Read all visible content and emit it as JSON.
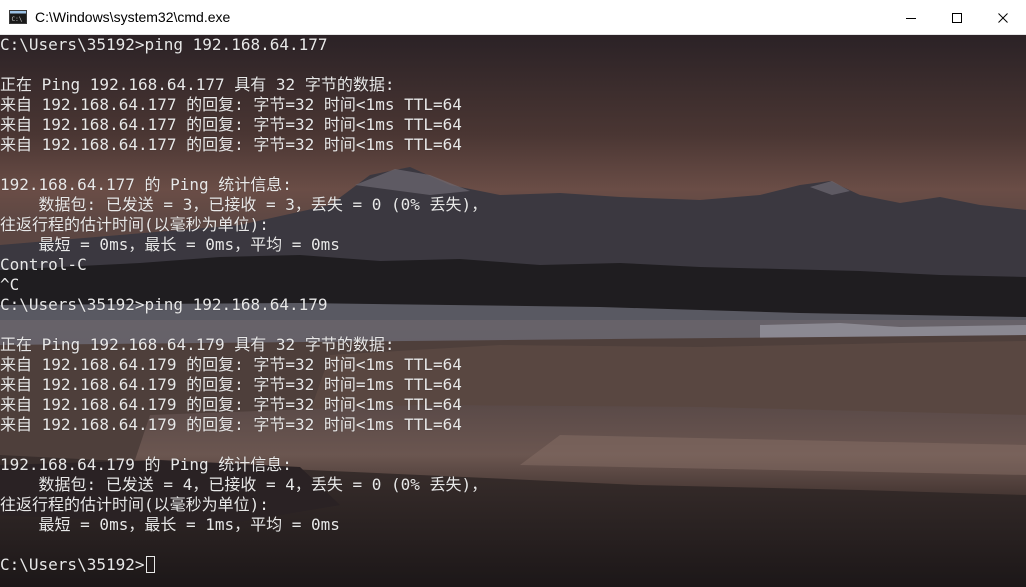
{
  "window": {
    "title": "C:\\Windows\\system32\\cmd.exe",
    "app_icon": "cmd-icon",
    "controls": [
      "minimize-icon",
      "maximize-icon",
      "close-icon"
    ]
  },
  "console": {
    "text_color": "#e8e8e8",
    "lines": [
      "C:\\Users\\35192>ping 192.168.64.177",
      "",
      "正在 Ping 192.168.64.177 具有 32 字节的数据:",
      "来自 192.168.64.177 的回复: 字节=32 时间<1ms TTL=64",
      "来自 192.168.64.177 的回复: 字节=32 时间<1ms TTL=64",
      "来自 192.168.64.177 的回复: 字节=32 时间<1ms TTL=64",
      "",
      "192.168.64.177 的 Ping 统计信息:",
      "    数据包: 已发送 = 3，已接收 = 3，丢失 = 0 (0% 丢失)，",
      "往返行程的估计时间(以毫秒为单位):",
      "    最短 = 0ms，最长 = 0ms，平均 = 0ms",
      "Control-C",
      "^C",
      "C:\\Users\\35192>ping 192.168.64.179",
      "",
      "正在 Ping 192.168.64.179 具有 32 字节的数据:",
      "来自 192.168.64.179 的回复: 字节=32 时间<1ms TTL=64",
      "来自 192.168.64.179 的回复: 字节=32 时间=1ms TTL=64",
      "来自 192.168.64.179 的回复: 字节=32 时间<1ms TTL=64",
      "来自 192.168.64.179 的回复: 字节=32 时间<1ms TTL=64",
      "",
      "192.168.64.179 的 Ping 统计信息:",
      "    数据包: 已发送 = 4，已接收 = 4，丢失 = 0 (0% 丢失)，",
      "往返行程的估计时间(以毫秒为单位):",
      "    最短 = 0ms，最长 = 1ms，平均 = 0ms",
      "",
      "C:\\Users\\35192>"
    ]
  }
}
